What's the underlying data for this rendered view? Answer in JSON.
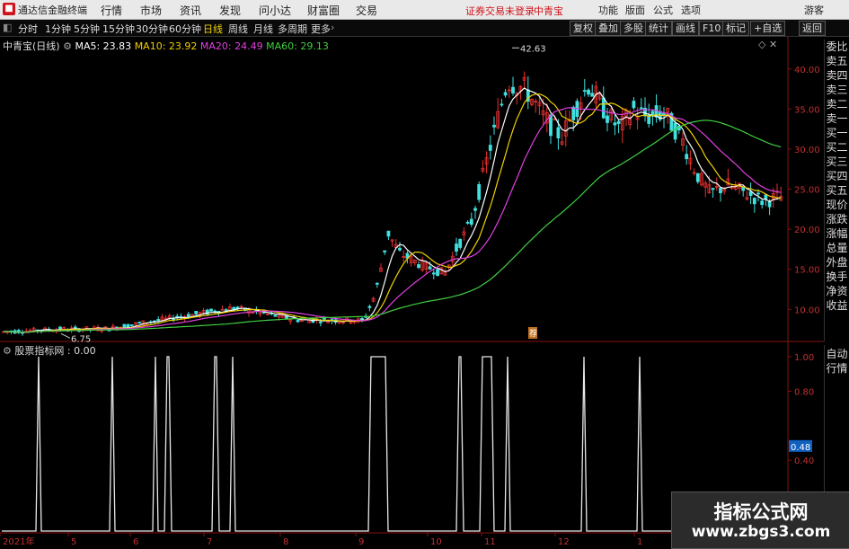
{
  "titlebar": {
    "app_title": "通达信金融终端",
    "menu": [
      "行情",
      "市场",
      "资讯",
      "发现",
      "问小达",
      "财富圈",
      "交易"
    ],
    "warning": "证券交易未登录",
    "stock_name": "中青宝",
    "right_menu": [
      "功能",
      "版面",
      "公式",
      "选项"
    ],
    "guest": "游客"
  },
  "toolbar": {
    "periods": [
      "分时",
      "1分钟",
      "5分钟",
      "15分钟",
      "30分钟",
      "60分钟",
      "日线",
      "周线",
      "月线",
      "多周期",
      "更多"
    ],
    "active_period": "日线",
    "buttons": [
      "复权",
      "叠加",
      "多股",
      "统计",
      "画线",
      "F10",
      "标记",
      "+自选",
      "返回"
    ]
  },
  "main_chart": {
    "stock_label": "中青宝(日线)",
    "ma": [
      {
        "label": "MA5: 23.83",
        "color": "#ffffff"
      },
      {
        "label": "MA10: 23.92",
        "color": "#f0d000"
      },
      {
        "label": "MA20: 24.49",
        "color": "#e040e0"
      },
      {
        "label": "MA60: 29.13",
        "color": "#40d040"
      }
    ],
    "y_ticks": [
      "40.00",
      "35.00",
      "30.00",
      "25.00",
      "20.00",
      "15.00",
      "10.00"
    ],
    "high_label": "42.63",
    "low_label": "6.75",
    "event_marker": "荐"
  },
  "indicator": {
    "label": "股票指标网 : 0.00",
    "y_ticks": [
      "1.00",
      "0.80",
      "0.48",
      "0.40"
    ],
    "current_value": "0.48"
  },
  "x_axis": [
    "2021年",
    "5",
    "6",
    "7",
    "8",
    "9",
    "10",
    "11",
    "12",
    "1"
  ],
  "right_panel": {
    "items": [
      "委比",
      "卖五",
      "卖四",
      "卖三",
      "卖二",
      "卖一",
      "买一",
      "买二",
      "买三",
      "买四",
      "买五",
      "现价",
      "涨跌",
      "涨幅",
      "总量",
      "外盘",
      "换手",
      "净资",
      "收益"
    ],
    "lower_items": [
      "自动",
      "行情"
    ]
  },
  "watermark": {
    "title": "指标公式网",
    "url": "www.zbgs3.com"
  },
  "colors": {
    "up": "#e83030",
    "down": "#40e0e0",
    "ma5": "#ffffff",
    "ma10": "#f0d000",
    "ma20": "#e040e0",
    "ma60": "#40d040",
    "axis_red": "#8a1010"
  },
  "chart_data": {
    "type": "line",
    "price_series": {
      "x": [
        "2021-04",
        "2021-05",
        "2021-06",
        "2021-07",
        "2021-08",
        "2021-09",
        "2021-09b",
        "2021-10",
        "2021-10b",
        "2021-11",
        "2021-11b",
        "2021-12",
        "2021-12b",
        "2022-01"
      ],
      "close": [
        7.2,
        7.5,
        8.5,
        10.0,
        8.5,
        8.8,
        20.0,
        16.5,
        18.0,
        38.0,
        33.0,
        36.0,
        32.0,
        24.0
      ],
      "ma60": [
        7.2,
        7.4,
        7.8,
        8.3,
        8.3,
        8.5,
        10.5,
        13.5,
        17.0,
        22.0,
        29.0,
        33.5,
        32.0,
        29.13
      ]
    },
    "indicator_signal": {
      "ylim": [
        0,
        1
      ],
      "pulse_starts": [
        "2021-04",
        "2021-05",
        "2021-06a",
        "2021-06b",
        "2021-06c",
        "2021-07a",
        "2021-07b",
        "2021-09",
        "2021-10a",
        "2021-10b",
        "2021-11a",
        "2021-11b",
        "2021-12",
        "2022-01"
      ],
      "values_on": 1.0,
      "values_off": 0.0
    },
    "ylim_price": [
      6,
      43
    ]
  }
}
